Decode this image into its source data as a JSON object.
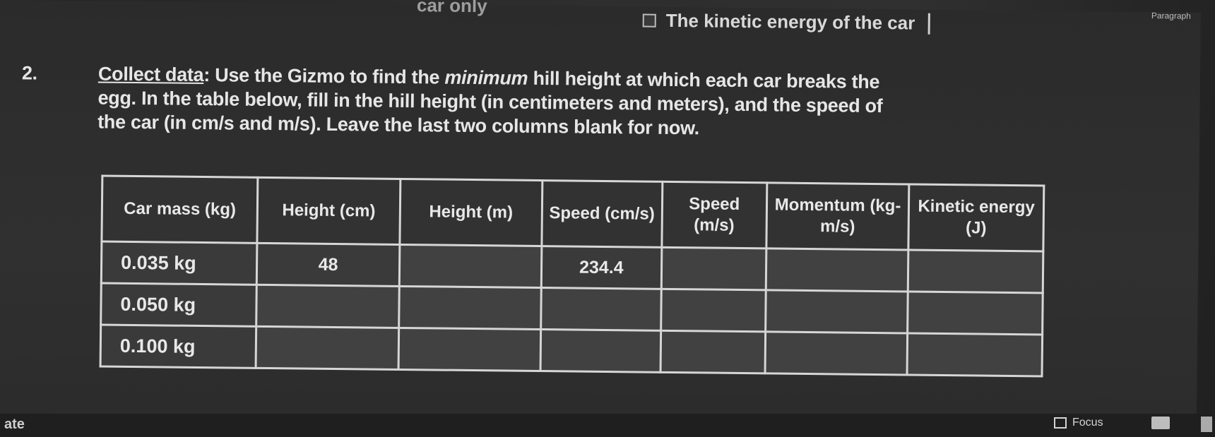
{
  "top_text": {
    "partial": "car only",
    "option": "The kinetic energy of the car",
    "right_label": "Paragraph"
  },
  "question": {
    "number": "2.",
    "lead": "Collect data",
    "text_1": ": Use the Gizmo to find the ",
    "emphasis": "minimum",
    "text_2": " hill height at which each car breaks the egg. In the table below, fill in the hill height (in centimeters and meters), and the speed of the car (in cm/s and m/s). Leave the last two columns blank for now."
  },
  "table": {
    "headers": [
      "Car mass (kg)",
      "Height (cm)",
      "Height (m)",
      "Speed (cm/s)",
      "Speed (m/s)",
      "Momentum (kg-m/s)",
      "Kinetic energy (J)"
    ],
    "rows": [
      [
        "0.035 kg",
        "48",
        "",
        "234.4",
        "",
        "",
        ""
      ],
      [
        "0.050 kg",
        "",
        "",
        "",
        "",
        "",
        ""
      ],
      [
        "0.100 kg",
        "",
        "",
        "",
        "",
        "",
        ""
      ]
    ]
  },
  "taskbar": {
    "left_label": "ate",
    "focus_label": "Focus"
  }
}
